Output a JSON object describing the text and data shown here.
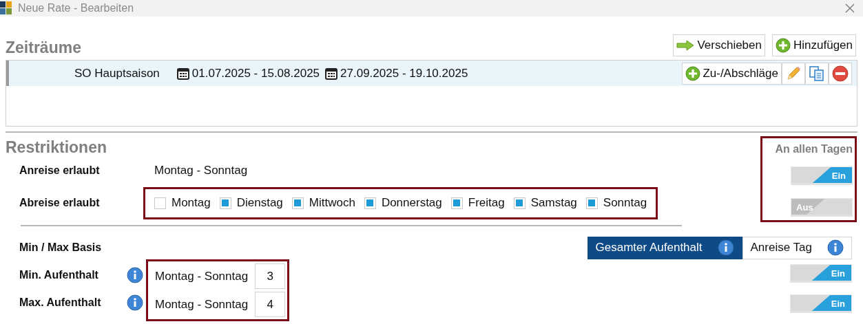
{
  "window": {
    "title": "Neue Rate - Bearbeiten"
  },
  "periods": {
    "heading": "Zeiträume",
    "buttons": [
      {
        "kind": "arrow",
        "label": "Verschieben"
      },
      {
        "kind": "plus",
        "label": "Hinzufügen"
      }
    ],
    "rows": [
      {
        "name": "SO Hauptsaison",
        "ranges": [
          "01.07.2025 - 15.08.2025",
          "27.09.2025 - 19.10.2025"
        ],
        "selected": true,
        "actions": [
          {
            "kind": "plus",
            "label": "Zu-/Abschläge"
          },
          {
            "kind": "edit"
          },
          {
            "kind": "copy"
          },
          {
            "kind": "remove"
          }
        ]
      }
    ]
  },
  "restrictions": {
    "heading": "Restriktionen",
    "all_days_heading": "An allen Tagen",
    "arrival": {
      "label": "Anreise erlaubt",
      "value": "Montag - Sonntag",
      "all_days": {
        "on": true,
        "label": "Ein"
      }
    },
    "departure": {
      "label": "Abreise erlaubt",
      "days": [
        {
          "label": "Montag",
          "checked": false
        },
        {
          "label": "Dienstag",
          "checked": true
        },
        {
          "label": "Mittwoch",
          "checked": true
        },
        {
          "label": "Donnerstag",
          "checked": true
        },
        {
          "label": "Freitag",
          "checked": true
        },
        {
          "label": "Samstag",
          "checked": true
        },
        {
          "label": "Sonntag",
          "checked": true
        }
      ],
      "all_days": {
        "on": false,
        "label": "Aus"
      }
    },
    "basis": {
      "label": "Min / Max Basis",
      "options": [
        {
          "label": "Gesamter Aufenthalt",
          "selected": true
        },
        {
          "label": "Anreise Tag",
          "selected": false
        }
      ]
    },
    "stays": [
      {
        "label": "Min. Aufenthalt",
        "days": "Montag - Sonntag",
        "value": "3",
        "all_days": {
          "on": true,
          "label": "Ein"
        }
      },
      {
        "label": "Max. Aufenthalt",
        "days": "Montag - Sonntag",
        "value": "4",
        "all_days": {
          "on": true,
          "label": "Ein"
        }
      }
    ]
  }
}
